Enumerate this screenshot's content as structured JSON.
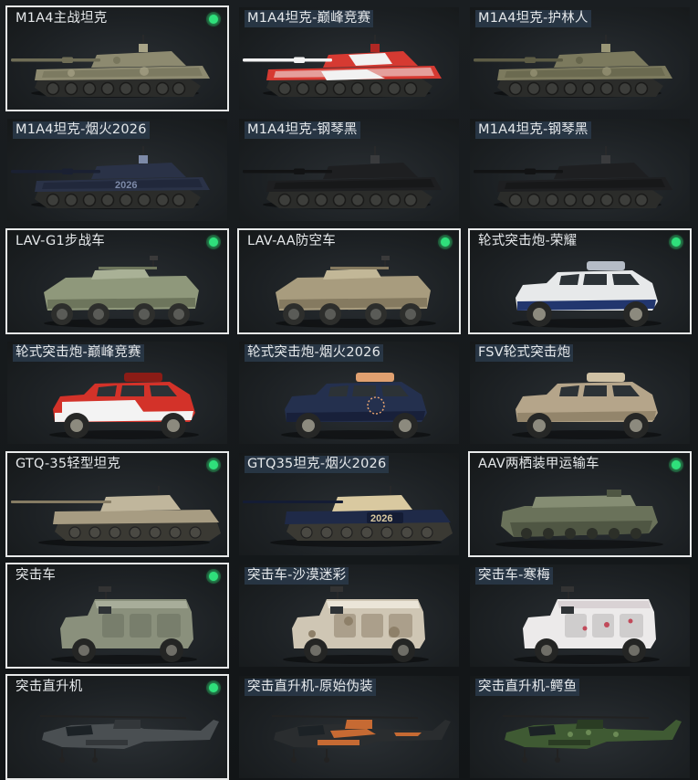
{
  "vehicles": [
    {
      "name": "M1A4主战坦克",
      "owned": true,
      "type": "tank",
      "skin": "desert",
      "colors": [
        "#8d8a70",
        "#6f6d56",
        "#a8a487"
      ]
    },
    {
      "name": "M1A4坦克-巅峰竞赛",
      "owned": false,
      "type": "tank",
      "skin": "race",
      "colors": [
        "#d63a32",
        "#f2f2f2",
        "#b02824"
      ]
    },
    {
      "name": "M1A4坦克-护林人",
      "owned": false,
      "type": "tank",
      "skin": "forest",
      "colors": [
        "#7c7a5e",
        "#5d5c45",
        "#9a9777"
      ]
    },
    {
      "name": "M1A4坦克-烟火2026",
      "owned": false,
      "type": "tank",
      "skin": "firework",
      "colors": [
        "#2a3247",
        "#1a2032",
        "#7d8aa8"
      ]
    },
    {
      "name": "M1A4坦克-钢琴黑",
      "owned": false,
      "type": "tank",
      "skin": "black",
      "colors": [
        "#1e1f21",
        "#121314",
        "#3a3b3d"
      ]
    },
    {
      "name": "M1A4坦克-钢琴黑",
      "owned": false,
      "type": "tank",
      "skin": "black",
      "colors": [
        "#1e1f21",
        "#121314",
        "#3a3b3d"
      ]
    },
    {
      "name": "LAV-G1步战车",
      "owned": true,
      "type": "apc",
      "skin": "green",
      "colors": [
        "#8f987b",
        "#6d755c",
        "#a9b196"
      ]
    },
    {
      "name": "LAV-AA防空车",
      "owned": true,
      "type": "apc",
      "skin": "sand",
      "colors": [
        "#a89c7e",
        "#857a60",
        "#c2b797"
      ]
    },
    {
      "name": "轮式突击炮-荣耀",
      "owned": true,
      "type": "armored_car",
      "skin": "glory",
      "colors": [
        "#e7e9ea",
        "#22366e",
        "#b5bcc6"
      ]
    },
    {
      "name": "轮式突击炮-巅峰竞赛",
      "owned": false,
      "type": "armored_car",
      "skin": "race",
      "colors": [
        "#d33229",
        "#f3f3f3",
        "#8b1c16"
      ]
    },
    {
      "name": "轮式突击炮-烟火2026",
      "owned": false,
      "type": "armored_car",
      "skin": "firework",
      "colors": [
        "#24304e",
        "#18203a",
        "#e0a070"
      ]
    },
    {
      "name": "FSV轮式突击炮",
      "owned": false,
      "type": "armored_car",
      "skin": "sand",
      "colors": [
        "#b5a58a",
        "#93856b",
        "#cfc1a4"
      ]
    },
    {
      "name": "GTQ-35轻型坦克",
      "owned": true,
      "type": "light_tank",
      "skin": "sand",
      "colors": [
        "#a79c82",
        "#857b63",
        "#c0b69c"
      ]
    },
    {
      "name": "GTQ35坦克-烟火2026",
      "owned": false,
      "type": "light_tank",
      "skin": "firework",
      "colors": [
        "#1f2a48",
        "#141c34",
        "#d9c9a0"
      ]
    },
    {
      "name": "AAV两栖装甲运输车",
      "owned": true,
      "type": "amphibious",
      "skin": "green",
      "colors": [
        "#6a725a",
        "#4f5643",
        "#858d73"
      ]
    },
    {
      "name": "突击车",
      "owned": true,
      "type": "mrap",
      "skin": "grey",
      "colors": [
        "#8a907c",
        "#6a705e",
        "#a8ad9a"
      ]
    },
    {
      "name": "突击车-沙漠迷彩",
      "owned": false,
      "type": "mrap",
      "skin": "desert",
      "colors": [
        "#cfc6b4",
        "#8e8069",
        "#ebe5d8"
      ]
    },
    {
      "name": "突击车-寒梅",
      "owned": false,
      "type": "mrap",
      "skin": "plum",
      "colors": [
        "#eceaea",
        "#b8b4b4",
        "#d9d2d4"
      ]
    },
    {
      "name": "突击直升机",
      "owned": true,
      "type": "helicopter",
      "skin": "grey",
      "colors": [
        "#4a4f52",
        "#33373a",
        "#6c7174"
      ]
    },
    {
      "name": "突击直升机-原始伪装",
      "owned": false,
      "type": "helicopter",
      "skin": "tribal",
      "colors": [
        "#2a2d2f",
        "#c66a33",
        "#151718"
      ]
    },
    {
      "name": "突击直升机-鳄鱼",
      "owned": false,
      "type": "helicopter",
      "skin": "croc",
      "colors": [
        "#3f5a33",
        "#2a3c23",
        "#6b8a55"
      ]
    }
  ]
}
